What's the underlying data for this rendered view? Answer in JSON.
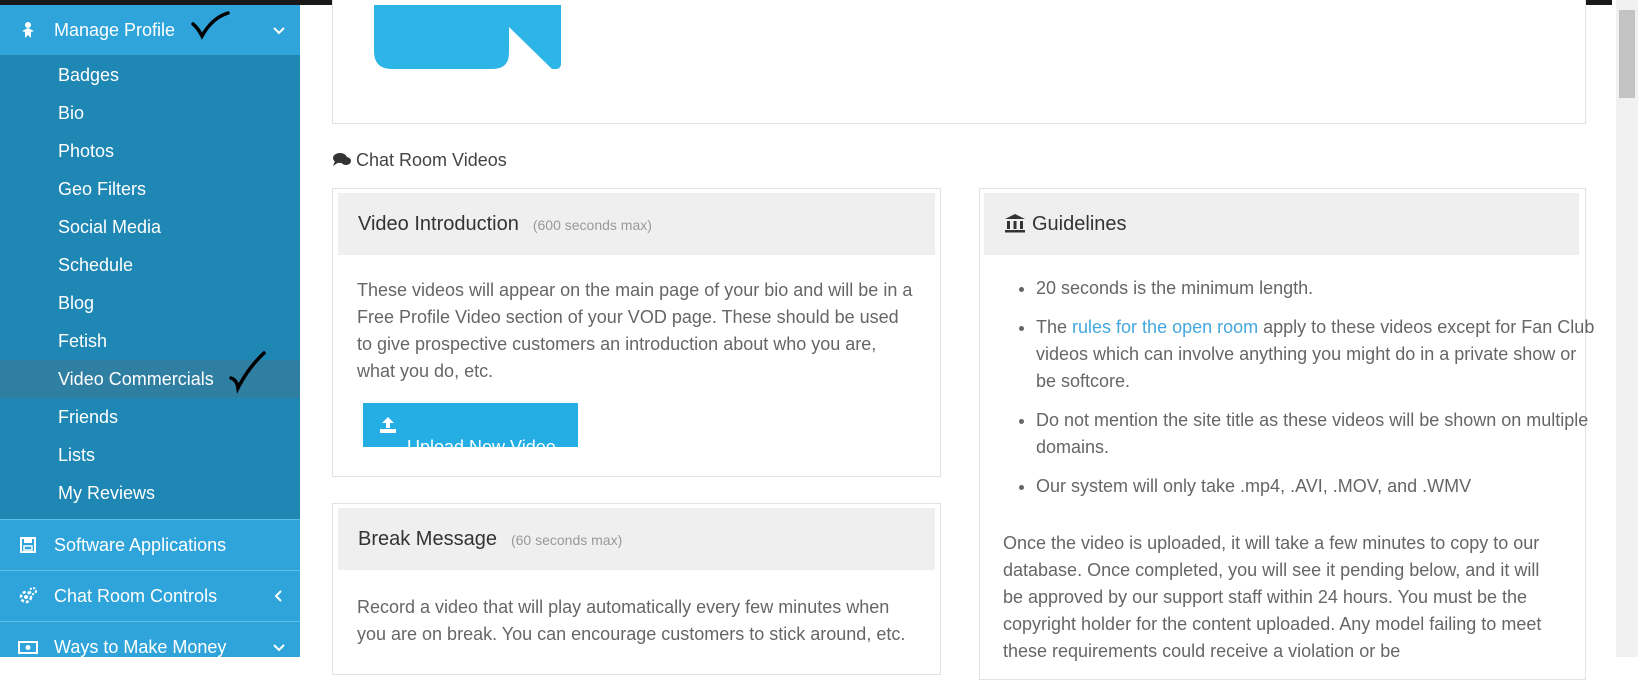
{
  "sidebar": {
    "manage_profile": "Manage Profile",
    "items": [
      {
        "label": "Badges"
      },
      {
        "label": "Bio"
      },
      {
        "label": "Photos"
      },
      {
        "label": "Geo Filters"
      },
      {
        "label": "Social Media"
      },
      {
        "label": "Schedule"
      },
      {
        "label": "Blog"
      },
      {
        "label": "Fetish"
      },
      {
        "label": "Video Commercials"
      },
      {
        "label": "Friends"
      },
      {
        "label": "Lists"
      },
      {
        "label": "My Reviews"
      }
    ],
    "software_applications": "Software Applications",
    "chat_room_controls": "Chat Room Controls",
    "ways_to_make_money": "Ways to Make Money"
  },
  "main": {
    "section_title": "Chat Room Videos",
    "video_intro": {
      "title": "Video Introduction",
      "limit": "(600 seconds max)",
      "description": "These videos will appear on the main page of your bio and will be in a Free Profile Video section of your VOD page. These should be used to give prospective customers an introduction about who you are, what you do, etc.",
      "upload_label": "Upload New Video"
    },
    "break_message": {
      "title": "Break Message",
      "limit": "(60 seconds max)",
      "description": "Record a video that will play automatically every few minutes when you are on break. You can encourage customers to stick around, etc."
    },
    "guidelines": {
      "title": "Guidelines",
      "item1": "20 seconds is the minimum length.",
      "item2_prefix": "The ",
      "item2_link": "rules for the open room",
      "item2_suffix": " apply to these videos except for Fan Club videos which can involve anything you might do in a private show or be softcore.",
      "item3": "Do not mention the site title as these videos will be shown on multiple domains.",
      "item4": "Our system will only take .mp4, .AVI, .MOV, and .WMV",
      "paragraph": "Once the video is uploaded, it will take a few minutes to copy to our database. Once completed, you will see it pending below, and it will be approved by our support staff within 24 hours. You must be the copyright holder for the content uploaded. Any model failing to meet these requirements could receive a violation or be"
    }
  },
  "colors": {
    "sidebar_bg": "#1e87b3",
    "sidebar_header": "#2ea4db",
    "accent": "#25aee4",
    "link": "#44a7dd"
  },
  "icons": [
    "user-icon",
    "chevron-down-icon",
    "save-icon",
    "cogs-icon",
    "chevron-left-icon",
    "money-icon",
    "comments-icon",
    "upload-icon",
    "bank-icon"
  ]
}
